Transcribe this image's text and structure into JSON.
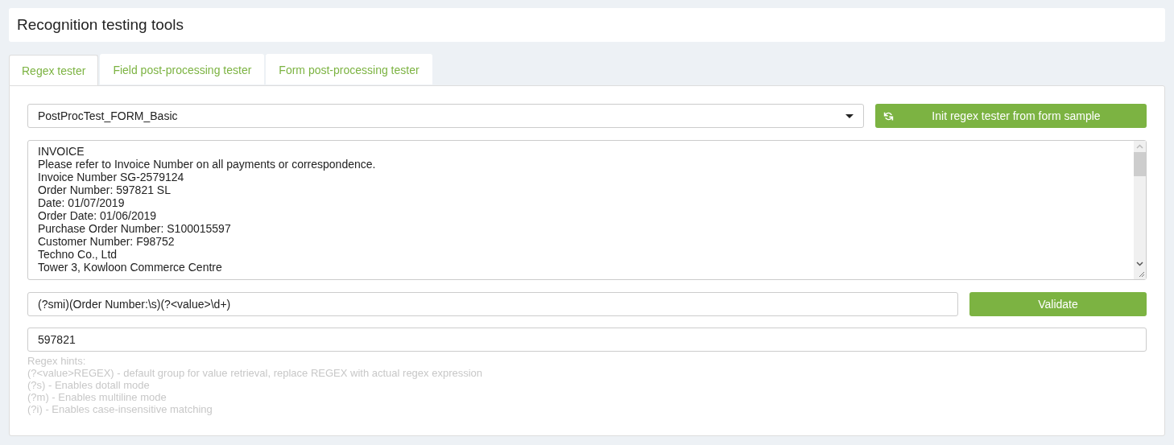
{
  "header": {
    "title": "Recognition testing tools"
  },
  "tabs": [
    {
      "label": "Regex tester",
      "selected": true
    },
    {
      "label": "Field post-processing tester",
      "selected": false
    },
    {
      "label": "Form post-processing tester",
      "selected": false
    }
  ],
  "form_select": {
    "value": "PostProcTest_FORM_Basic"
  },
  "init_button": {
    "label": "Init regex tester from form sample"
  },
  "sample_text": {
    "lines": [
      "INVOICE",
      "Please refer to Invoice Number on all payments or correspondence.",
      "Invoice Number SG-2579124",
      "Order Number: 597821 SL",
      "Date: 01/07/2019",
      "Order Date: 01/06/2019",
      "Purchase Order Number: S100015597",
      "Customer Number: F98752",
      "Techno Co., Ltd",
      "Tower 3, Kowloon Commerce Centre"
    ]
  },
  "regex_field": {
    "value": "(?smi)(Order Number:\\s)(?<value>\\d+)"
  },
  "validate_button": {
    "label": "Validate"
  },
  "result_field": {
    "value": "597821"
  },
  "hints": [
    "Regex hints:",
    "(?<value>REGEX) - default group for value retrieval, replace REGEX with actual regex expression",
    "(?s) - Enables dotall mode",
    "(?m) - Enables multiline mode",
    "(?i) - Enables case-insensitive matching"
  ]
}
